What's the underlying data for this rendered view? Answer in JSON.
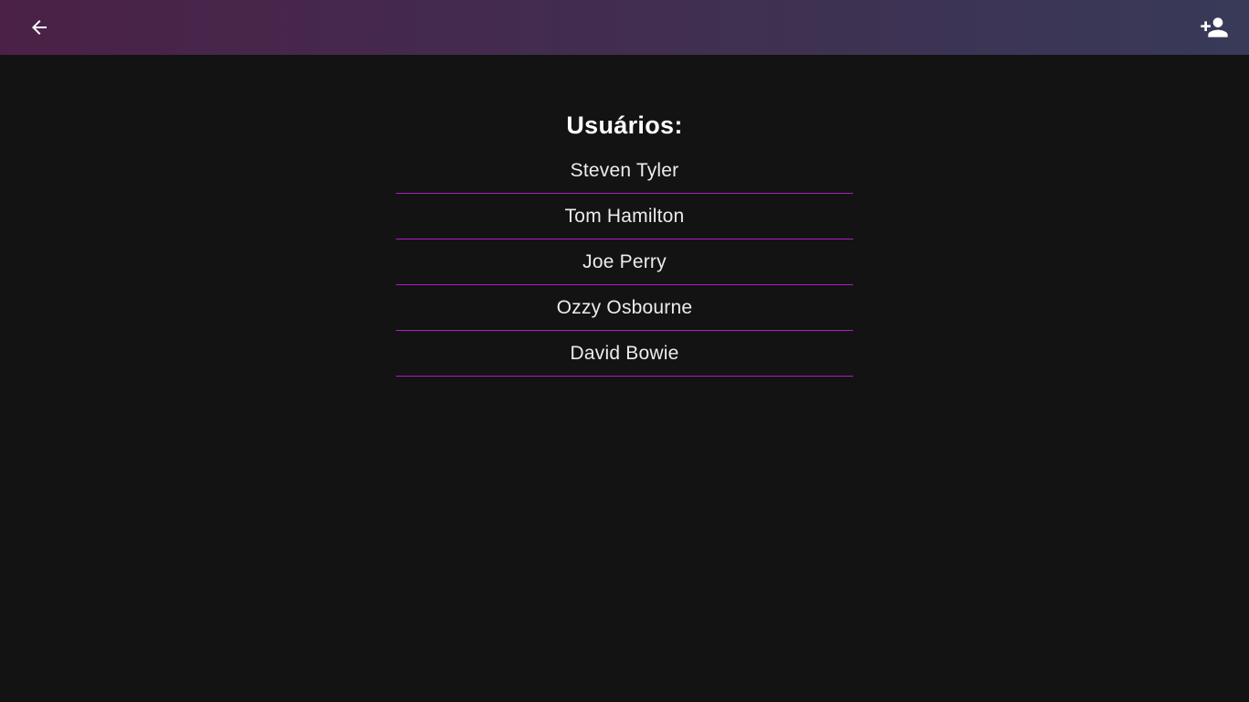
{
  "header": {
    "back_icon": "arrow-back-icon",
    "add_user_icon": "person-add-icon",
    "gradient_start": "#4b2147",
    "gradient_end": "#383a58"
  },
  "main": {
    "title": "Usuários:",
    "accent_color": "#b21bc9",
    "users": [
      "Steven Tyler",
      "Tom Hamilton",
      "Joe Perry",
      "Ozzy Osbourne",
      "David Bowie"
    ]
  }
}
